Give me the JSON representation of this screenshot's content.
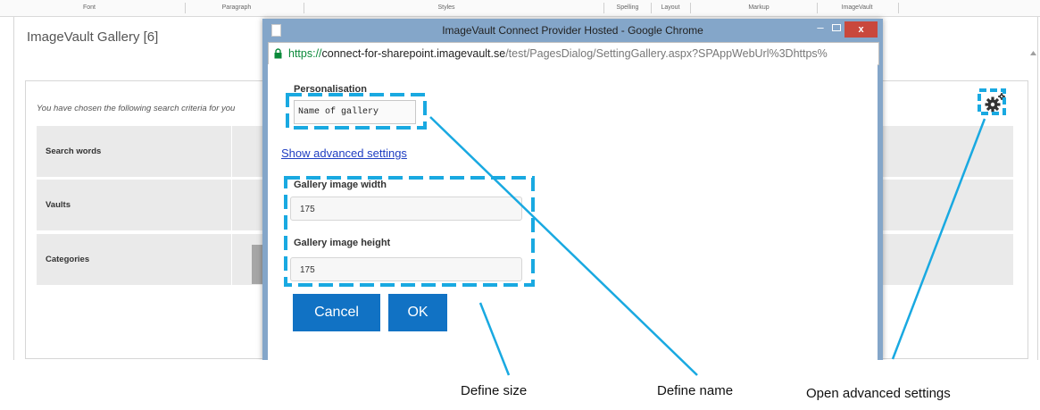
{
  "ribbon": {
    "groups": [
      "Font",
      "Paragraph",
      "Styles",
      "Spelling",
      "Layout",
      "Markup",
      "ImageVault"
    ]
  },
  "sharepoint": {
    "gallery_title": "ImageVault Gallery [6]",
    "criteria_intro": "You have chosen the following search criteria for you",
    "rows": [
      {
        "label": "Search words"
      },
      {
        "label": "Vaults"
      },
      {
        "label": "Categories"
      }
    ],
    "settings_icon": "gear-icon"
  },
  "popup": {
    "window_title": "ImageVault Connect Provider Hosted - Google Chrome",
    "url_scheme": "https://",
    "url_host": "connect-for-sharepoint.imagevault.se",
    "url_path": "/test/PagesDialog/SettingGallery.aspx?SPAppWebUrl%3Dhttps%",
    "personalisation_label": "Personalisation",
    "name_value": "Name of gallery",
    "advanced_link": "Show advanced settings",
    "width_label": "Gallery image width",
    "width_value": "175",
    "height_label": "Gallery image height",
    "height_value": "175",
    "cancel_label": "Cancel",
    "ok_label": "OK",
    "close_symbol": "x"
  },
  "callouts": {
    "define_size": "Define size",
    "define_name": "Define name",
    "open_advanced": "Open advanced settings"
  },
  "colors": {
    "callout_blue": "#19a9e1",
    "button_blue": "#1172c4",
    "popup_frame": "#84a6c9",
    "close_red": "#c9483c"
  }
}
